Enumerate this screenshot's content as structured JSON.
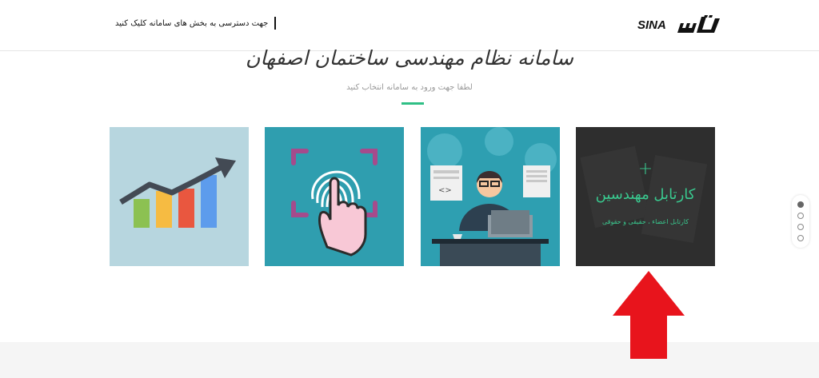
{
  "header": {
    "hint_text": "جهت دسترسی به بخش های سامانه کلیک کنید",
    "logo_text": "SINA"
  },
  "main": {
    "title": "سامانه نظام مهندسی ساختمان اصفهان",
    "subtitle": "لطفا جهت ورود به سامانه انتخاب کنید"
  },
  "cards": [
    {
      "icon": "growth-chart-icon",
      "bg_color": "#b7d6df"
    },
    {
      "icon": "fingerprint-touch-icon",
      "bg_color": "#2f9eaf"
    },
    {
      "icon": "developer-desk-icon",
      "bg_color": "#2e9fb1"
    },
    {
      "icon": "plus-icon",
      "bg_color": "#2e2e2e",
      "plus_symbol": "+",
      "title": "کارتابل مهندسین",
      "subtitle": "کارتابل اعضاء ، حقیقی و حقوقی",
      "accent_color": "#39c98f"
    }
  ],
  "pagination": {
    "total": 4,
    "active": 1
  },
  "annotation": {
    "icon": "red-up-arrow-icon",
    "color": "#e8141c"
  }
}
